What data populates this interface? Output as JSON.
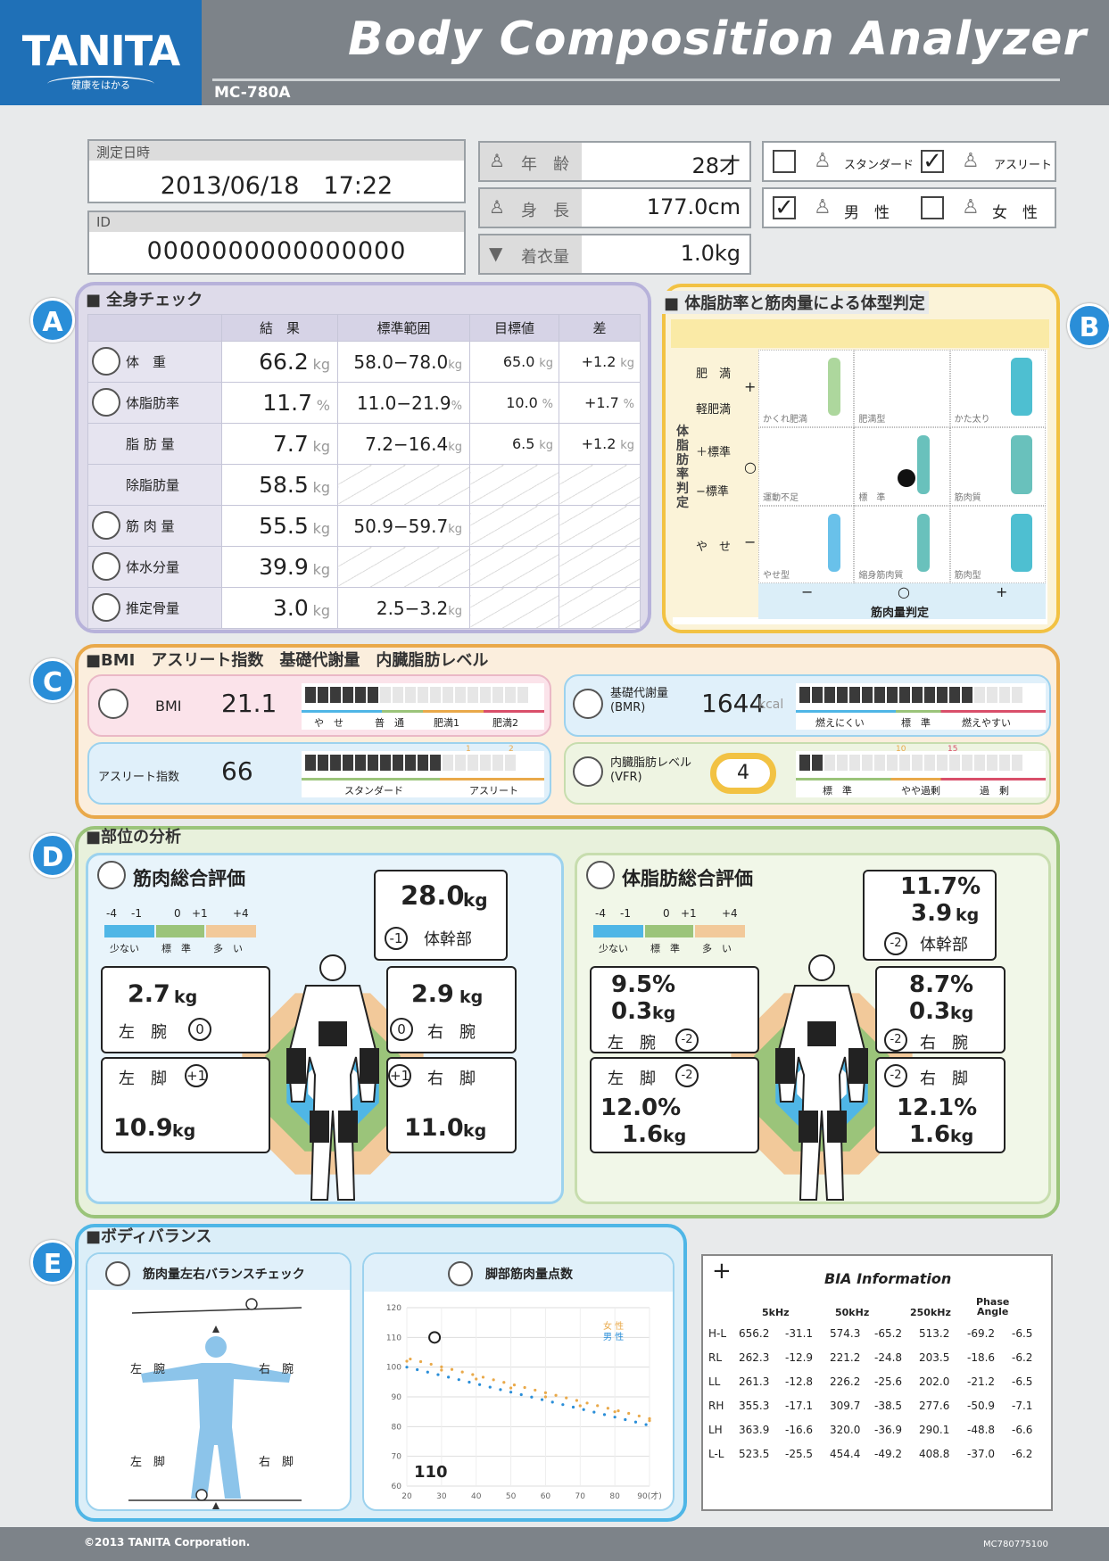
{
  "header": {
    "brand": "TANITA",
    "brand_sub": "健康をはかる",
    "title": "Body Composition Analyzer",
    "model": "MC-780A"
  },
  "info": {
    "date_label": "測定日時",
    "date": "2013/06/18　17:22",
    "id_label": "ID",
    "id": "0000000000000000",
    "age_label": "年　齢",
    "age": "28才",
    "height_label": "身　長",
    "height": "177.0cm",
    "cloth_label": "着衣量",
    "cloth": "1.0kg",
    "standard_label": "スタンダード",
    "athlete_label": "アスリート",
    "male_label": "男　性",
    "female_label": "女　性",
    "standard_checked": "",
    "athlete_checked": "✓",
    "male_checked": "✓",
    "female_checked": ""
  },
  "secA": {
    "badge": "A",
    "title": "■ 全身チェック",
    "cols": [
      "結　果",
      "標準範囲",
      "目標値",
      "差"
    ],
    "rows": [
      {
        "name": "体　重",
        "result": "66.2",
        "ru": "kg",
        "range": "58.0−78.0",
        "rgu": "kg",
        "goal": "65.0",
        "gu": "kg",
        "diff": "+1.2",
        "du": "kg"
      },
      {
        "name": "体脂肪率",
        "result": "11.7",
        "ru": "%",
        "range": "11.0−21.9",
        "rgu": "%",
        "goal": "10.0",
        "gu": "%",
        "diff": "+1.7",
        "du": "%"
      },
      {
        "name": "脂 肪 量",
        "result": "7.7",
        "ru": "kg",
        "range": "7.2−16.4",
        "rgu": "kg",
        "goal": "6.5",
        "gu": "kg",
        "diff": "+1.2",
        "du": "kg"
      },
      {
        "name": "除脂肪量",
        "result": "58.5",
        "ru": "kg",
        "range": "",
        "rgu": "",
        "goal": "",
        "gu": "",
        "diff": "",
        "du": ""
      },
      {
        "name": "筋 肉 量",
        "result": "55.5",
        "ru": "kg",
        "range": "50.9−59.7",
        "rgu": "kg",
        "goal": "",
        "gu": "",
        "diff": "",
        "du": ""
      },
      {
        "name": "体水分量",
        "result": "39.9",
        "ru": "kg",
        "range": "",
        "rgu": "",
        "goal": "",
        "gu": "",
        "diff": "",
        "du": ""
      },
      {
        "name": "推定骨量",
        "result": "3.0",
        "ru": "kg",
        "range": "2.5−3.2",
        "rgu": "kg",
        "goal": "",
        "gu": "",
        "diff": "",
        "du": ""
      }
    ]
  },
  "secB": {
    "badge": "B",
    "title": "■ 体脂肪率と筋肉量による体型判定",
    "yaxis": "体脂肪率判定",
    "xaxis": "筋肉量判定",
    "yl": [
      "肥　満",
      "軽肥満",
      "＋標準",
      "−標準",
      "や　せ"
    ],
    "yl_marks": [
      "+",
      "○",
      "−"
    ],
    "cells": [
      "かくれ肥満",
      "肥満型",
      "かた太り",
      "運動不足",
      "標　準",
      "筋肉質",
      "やせ型",
      "縮身筋肉質",
      "筋肉型"
    ],
    "xl": [
      "−",
      "○",
      "+"
    ]
  },
  "secC": {
    "badge": "C",
    "title": "■BMI　アスリート指数　基礎代謝量　内臓脂肪レベル",
    "bmi_label": "BMI",
    "bmi": "21.1",
    "bmi_scale": [
      "や　せ",
      "普　通",
      "肥満1",
      "肥満2"
    ],
    "bmr_label": "基礎代謝量\n(BMR)",
    "bmr": "1644",
    "bmr_unit": "kcal",
    "bmr_scale": [
      "燃えにくい",
      "標　準",
      "燃えやすい"
    ],
    "ath_label": "アスリート指数",
    "ath": "66",
    "ath_scale": [
      "スタンダード",
      "アスリート"
    ],
    "vfr_label": "内臓脂肪レベル\n(VFR)",
    "vfr": "4",
    "vfr_scale": [
      "標　準",
      "やや過剰",
      "過　剰"
    ],
    "ath_ticks": [
      "1",
      "2"
    ],
    "vfr_ticks": [
      "10",
      "15"
    ]
  },
  "secD": {
    "badge": "D",
    "title": "■部位の分析",
    "scale_ticks": [
      "-4",
      "-1",
      "0",
      "+1",
      "+4"
    ],
    "scale_labels": [
      "少ない",
      "標　準",
      "多　い"
    ],
    "muscle": {
      "title": "筋肉総合評価",
      "trunk": "28.0",
      "trunk_u": "kg",
      "trunk_score": "-1",
      "trunk_label": "体幹部",
      "larm": "2.7",
      "larm_u": "kg",
      "larm_label": "左　腕",
      "larm_score": "0",
      "rarm": "2.9",
      "rarm_u": "kg",
      "rarm_label": "右　腕",
      "rarm_score": "0",
      "lleg_label": "左　脚",
      "lleg_score": "+1",
      "lleg": "10.9",
      "lleg_u": "kg",
      "rleg_label": "右　脚",
      "rleg_score": "+1",
      "rleg": "11.0",
      "rleg_u": "kg"
    },
    "fat": {
      "title": "体脂肪総合評価",
      "trunk_pct": "11.7%",
      "trunk": "3.9",
      "trunk_u": "kg",
      "trunk_score": "-2",
      "trunk_label": "体幹部",
      "larm_pct": "9.5%",
      "larm": "0.3",
      "larm_u": "kg",
      "larm_label": "左　腕",
      "larm_score": "-2",
      "rarm_pct": "8.7%",
      "rarm": "0.3",
      "rarm_u": "kg",
      "rarm_label": "右　腕",
      "rarm_score": "-2",
      "lleg_label": "左　脚",
      "lleg_score": "-2",
      "lleg_pct": "12.0%",
      "lleg": "1.6",
      "lleg_u": "kg",
      "rleg_label": "右　脚",
      "rleg_score": "-2",
      "rleg_pct": "12.1%",
      "rleg": "1.6",
      "rleg_u": "kg"
    }
  },
  "secE": {
    "badge": "E",
    "title": "■ボディバランス",
    "bal_title": "筋肉量左右バランスチェック",
    "bal_labels": [
      "左　腕",
      "右　腕",
      "左　脚",
      "右　脚"
    ],
    "leg_title": "脚部筋肉量点数",
    "leg_score": "110",
    "leg_legend": [
      "女 性",
      "男 性"
    ],
    "leg_y": [
      "120",
      "110",
      "100",
      "90",
      "80",
      "70",
      "60"
    ],
    "leg_x": [
      "20",
      "30",
      "40",
      "50",
      "60",
      "70",
      "80",
      "90(才)"
    ]
  },
  "bia": {
    "plus": "+",
    "title": "BIA Information",
    "cols": [
      "5kHz",
      "50kHz",
      "250kHz",
      "Phase\nAngle"
    ],
    "rows": [
      [
        "H-L",
        "656.2",
        "-31.1",
        "574.3",
        "-65.2",
        "513.2",
        "-69.2",
        "-6.5"
      ],
      [
        "RL",
        "262.3",
        "-12.9",
        "221.2",
        "-24.8",
        "203.5",
        "-18.6",
        "-6.2"
      ],
      [
        "LL",
        "261.3",
        "-12.8",
        "226.2",
        "-25.6",
        "202.0",
        "-21.2",
        "-6.5"
      ],
      [
        "RH",
        "355.3",
        "-17.1",
        "309.7",
        "-38.5",
        "277.6",
        "-50.9",
        "-7.1"
      ],
      [
        "LH",
        "363.9",
        "-16.6",
        "320.0",
        "-36.9",
        "290.1",
        "-48.8",
        "-6.6"
      ],
      [
        "L-L",
        "523.5",
        "-25.5",
        "454.4",
        "-49.2",
        "408.8",
        "-37.0",
        "-6.2"
      ]
    ]
  },
  "footer": {
    "copyright": "©2013 TANITA Corporation.",
    "code": "MC780775100"
  },
  "colors": {
    "blue": "#2a8ed8",
    "purple": "#b7b2da",
    "yellow": "#f2c243",
    "orange": "#e9a94a",
    "green": "#9bc47a",
    "cyan": "#4fb6e6"
  }
}
